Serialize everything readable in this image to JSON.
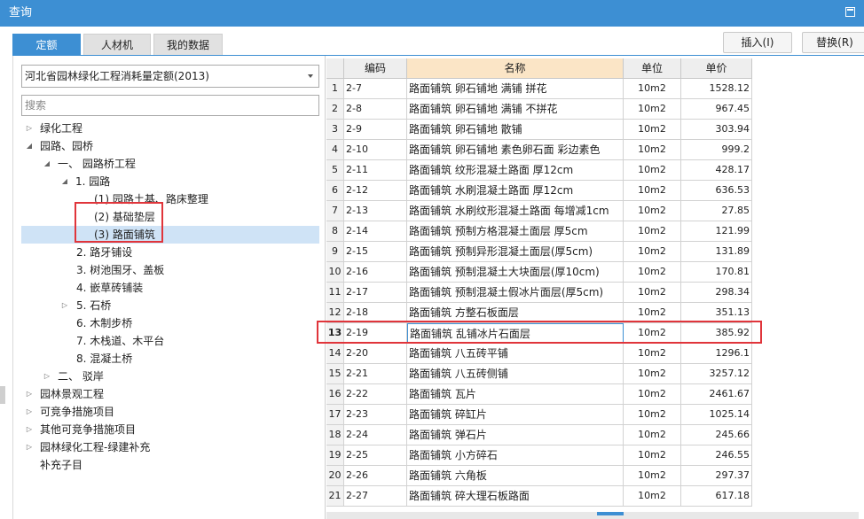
{
  "window": {
    "title": "查询"
  },
  "tabs": [
    "定额",
    "人材机",
    "我的数据"
  ],
  "buttons": {
    "insert": "插入(I)",
    "replace": "替换(R)"
  },
  "quota_select": {
    "value": "河北省园林绿化工程消耗量定额(2013)"
  },
  "search": {
    "placeholder": "搜索"
  },
  "tree": [
    {
      "label": "绿化工程",
      "arrow": "▷"
    },
    {
      "label": "园路、园桥",
      "arrow": "◢"
    },
    {
      "label": "一、 园路桥工程",
      "arrow": "◢"
    },
    {
      "label": "1. 园路",
      "arrow": "◢"
    },
    {
      "label": "(1) 园路土基、路床整理",
      "arrow": ""
    },
    {
      "label": "(2) 基础垫层",
      "arrow": ""
    },
    {
      "label": "(3) 路面铺筑",
      "arrow": ""
    },
    {
      "label": "2. 路牙铺设",
      "arrow": ""
    },
    {
      "label": "3. 树池围牙、盖板",
      "arrow": ""
    },
    {
      "label": "4. 嵌草砖铺装",
      "arrow": ""
    },
    {
      "label": "5. 石桥",
      "arrow": "▷"
    },
    {
      "label": "6. 木制步桥",
      "arrow": ""
    },
    {
      "label": "7. 木栈道、木平台",
      "arrow": ""
    },
    {
      "label": "8. 混凝土桥",
      "arrow": ""
    },
    {
      "label": "二、 驳岸",
      "arrow": "▷"
    },
    {
      "label": "园林景观工程",
      "arrow": "▷"
    },
    {
      "label": "可竞争措施项目",
      "arrow": "▷"
    },
    {
      "label": "其他可竞争措施项目",
      "arrow": "▷"
    },
    {
      "label": "园林绿化工程-绿建补充",
      "arrow": "▷"
    },
    {
      "label": "补充子目",
      "arrow": ""
    }
  ],
  "table": {
    "headers": {
      "code": "编码",
      "name": "名称",
      "unit": "单位",
      "price": "单价"
    },
    "rows": [
      {
        "idx": "1",
        "code": "2-7",
        "name": "路面铺筑 卵石铺地 满铺 拼花",
        "unit": "10m2",
        "price": "1528.12"
      },
      {
        "idx": "2",
        "code": "2-8",
        "name": "路面铺筑 卵石铺地 满铺 不拼花",
        "unit": "10m2",
        "price": "967.45"
      },
      {
        "idx": "3",
        "code": "2-9",
        "name": "路面铺筑 卵石铺地 散铺",
        "unit": "10m2",
        "price": "303.94"
      },
      {
        "idx": "4",
        "code": "2-10",
        "name": "路面铺筑 卵石铺地 素色卵石面 彩边素色",
        "unit": "10m2",
        "price": "999.2"
      },
      {
        "idx": "5",
        "code": "2-11",
        "name": "路面铺筑 纹形混凝土路面 厚12cm",
        "unit": "10m2",
        "price": "428.17"
      },
      {
        "idx": "6",
        "code": "2-12",
        "name": "路面铺筑 水刷混凝土路面 厚12cm",
        "unit": "10m2",
        "price": "636.53"
      },
      {
        "idx": "7",
        "code": "2-13",
        "name": "路面铺筑 水刷纹形混凝土路面 每增减1cm",
        "unit": "10m2",
        "price": "27.85"
      },
      {
        "idx": "8",
        "code": "2-14",
        "name": "路面铺筑 预制方格混凝土面层 厚5cm",
        "unit": "10m2",
        "price": "121.99"
      },
      {
        "idx": "9",
        "code": "2-15",
        "name": "路面铺筑 预制异形混凝土面层(厚5cm)",
        "unit": "10m2",
        "price": "131.89"
      },
      {
        "idx": "10",
        "code": "2-16",
        "name": "路面铺筑 预制混凝土大块面层(厚10cm)",
        "unit": "10m2",
        "price": "170.81"
      },
      {
        "idx": "11",
        "code": "2-17",
        "name": "路面铺筑 预制混凝土假冰片面层(厚5cm)",
        "unit": "10m2",
        "price": "298.34"
      },
      {
        "idx": "12",
        "code": "2-18",
        "name": "路面铺筑 方整石板面层",
        "unit": "10m2",
        "price": "351.13"
      },
      {
        "idx": "13",
        "code": "2-19",
        "name": "路面铺筑 乱铺冰片石面层",
        "unit": "10m2",
        "price": "385.92"
      },
      {
        "idx": "14",
        "code": "2-20",
        "name": "路面铺筑 八五砖平铺",
        "unit": "10m2",
        "price": "1296.1"
      },
      {
        "idx": "15",
        "code": "2-21",
        "name": "路面铺筑 八五砖侧铺",
        "unit": "10m2",
        "price": "3257.12"
      },
      {
        "idx": "16",
        "code": "2-22",
        "name": "路面铺筑 瓦片",
        "unit": "10m2",
        "price": "2461.67"
      },
      {
        "idx": "17",
        "code": "2-23",
        "name": "路面铺筑 碎缸片",
        "unit": "10m2",
        "price": "1025.14"
      },
      {
        "idx": "18",
        "code": "2-24",
        "name": "路面铺筑 弹石片",
        "unit": "10m2",
        "price": "245.66"
      },
      {
        "idx": "19",
        "code": "2-25",
        "name": "路面铺筑 小方碎石",
        "unit": "10m2",
        "price": "246.55"
      },
      {
        "idx": "20",
        "code": "2-26",
        "name": "路面铺筑 六角板",
        "unit": "10m2",
        "price": "297.37"
      },
      {
        "idx": "21",
        "code": "2-27",
        "name": "路面铺筑 碎大理石板路面",
        "unit": "10m2",
        "price": "617.18"
      }
    ]
  },
  "colors": {
    "accent": "#3d8fd3",
    "highlight": "#e0353b",
    "selected_bg": "#cfe3f6",
    "name_header_bg": "#fbe5c6"
  }
}
